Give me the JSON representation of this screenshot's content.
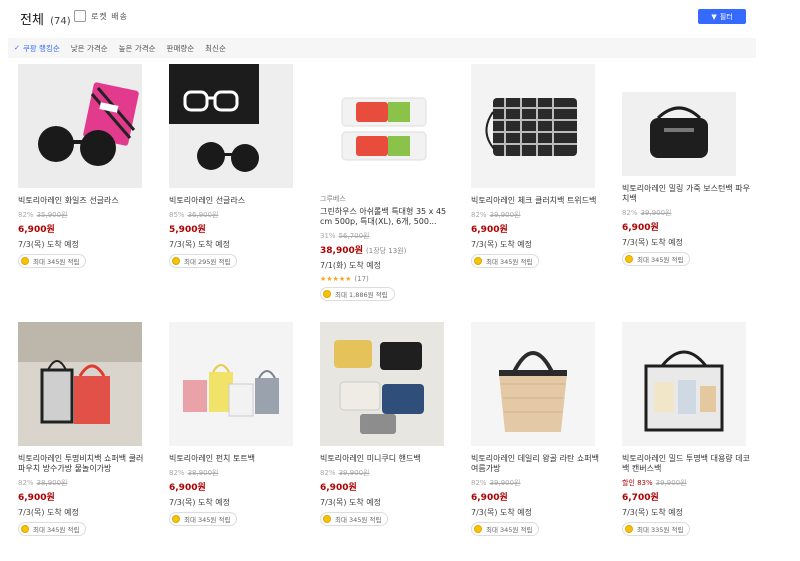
{
  "header": {
    "title": "전체",
    "count": "(74)",
    "checkbox_label": "로켓 배송",
    "filter_label": "필터"
  },
  "sort": {
    "items": [
      "쿠팡 랭킹순",
      "낮은 가격순",
      "높은 가격순",
      "판매량순",
      "최신순"
    ]
  },
  "products": [
    {
      "name": "빅토리아레인 화일즈 선글라스",
      "discount": "82%",
      "original": "35,900원",
      "price": "6,900원",
      "delivery": "7/3(목) 도착 예정",
      "reward": "최대 345원 적립"
    },
    {
      "name": "빅토리아레인 선글라스",
      "discount": "85%",
      "original": "36,900원",
      "price": "5,900원",
      "delivery": "7/3(목) 도착 예정",
      "reward": "최대 295원 적립"
    },
    {
      "brand": "그루베스",
      "name": "그린하우스 아쉬롤백 특대형 35 x 45 cm 500p, 특대(XL), 6개, 500...",
      "discount": "31%",
      "original": "56,700원",
      "price": "38,900원",
      "unit": "(1장당 13원)",
      "delivery": "7/1(화) 도착 예정",
      "stars": "★★★★★",
      "review_count": "(17)",
      "reward": "최대 1,886원 적립"
    },
    {
      "name": "빅토리아레인 체크 클러치백 트위드백",
      "discount": "82%",
      "original": "39,900원",
      "price": "6,900원",
      "delivery": "7/3(목) 도착 예정",
      "reward": "최대 345원 적립"
    },
    {
      "name": "빅토리아레인 밀링 가죽 보스턴백 파우치백",
      "discount": "82%",
      "original": "39,900원",
      "price": "6,900원",
      "delivery": "7/3(목) 도착 예정",
      "reward": "최대 345원 적립"
    },
    {
      "name": "빅토리아레인 투명비치백 쇼퍼백 쿨러파우치 방수가방 물놀이가방",
      "discount": "82%",
      "original": "38,900원",
      "price": "6,900원",
      "delivery": "7/3(목) 도착 예정",
      "reward": "최대 345원 적립"
    },
    {
      "name": "빅토리아레인 펀치 토트백",
      "discount": "82%",
      "original": "38,900원",
      "price": "6,900원",
      "delivery": "7/3(목) 도착 예정",
      "reward": "최대 345원 적립"
    },
    {
      "name": "빅토리아레인 미니쿠디 핸드백",
      "discount": "82%",
      "original": "39,900원",
      "price": "6,900원",
      "delivery": "7/3(목) 도착 예정",
      "reward": "최대 345원 적립"
    },
    {
      "name": "빅토리아레인 데일리 왕골 라탄 쇼퍼백 여름가방",
      "discount": "82%",
      "original": "39,900원",
      "price": "6,900원",
      "delivery": "7/3(목) 도착 예정",
      "reward": "최대 345원 적립"
    },
    {
      "name": "빅토리아레인 밀드 투명백 대용량 데코백 캔버스백",
      "discount": "할인 83%",
      "original": "39,900원",
      "price": "6,700원",
      "delivery": "7/3(목) 도착 예정",
      "reward": "최대 335원 적립"
    }
  ],
  "colors": {
    "accent": "#346aff",
    "price": "#ae0000",
    "coin": "#f7c300"
  }
}
